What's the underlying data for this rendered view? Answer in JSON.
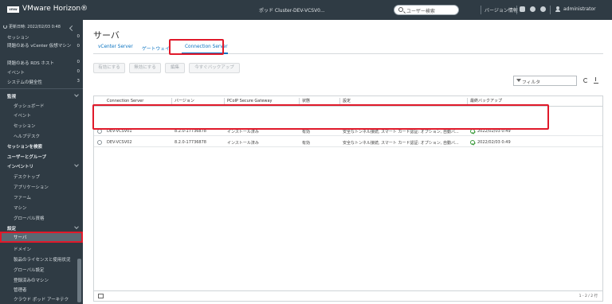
{
  "header": {
    "logo": "vmw",
    "brand": "VMware Horizon®",
    "pod_title": "ポッド Cluster-DEV-VCSV0...",
    "search_placeholder": "ユーザー検索",
    "version_info": "バージョン情報",
    "user": "administrator"
  },
  "sidebar": {
    "updated": "更新日時: 2022/02/03 0:48",
    "counts": [
      {
        "label": "セッション",
        "count": "0"
      },
      {
        "label": "問題のある vCenter 仮想マシン",
        "count": "0"
      },
      {
        "label": "問題のある RDS ホスト",
        "count": "0"
      },
      {
        "label": "イベント",
        "count": "0"
      },
      {
        "label": "システムの健全性",
        "count": "3"
      }
    ],
    "monitor": "監視",
    "monitor_items": [
      "ダッシュボード",
      "イベント",
      "セッション",
      "ヘルプデスク"
    ],
    "session_search": "セッションを検索",
    "users_groups": "ユーザーとグループ",
    "inventory": "インベントリ",
    "inventory_items": [
      "デスクトップ",
      "アプリケーション",
      "ファーム",
      "マシン",
      "グローバル資格"
    ],
    "settings": "設定",
    "settings_items": [
      "サーバ",
      "ドメイン",
      "製品のライセンスと使用状況",
      "グローバル設定",
      "登録済みのマシン",
      "管理者",
      "クラウド ポッド アーキテク"
    ]
  },
  "main": {
    "title": "サーバ",
    "tabs": [
      "vCenter Server",
      "ゲートウェイ",
      "Connection Server"
    ],
    "buttons": [
      "有効にする",
      "無効にする",
      "編集",
      "今すぐバックアップ"
    ],
    "filter_placeholder": "フィルタ",
    "columns": [
      "Connection Server",
      "バージョン",
      "PCoIP Secure Gateway",
      "状態",
      "設定",
      "最終バックアップ"
    ],
    "rows": [
      {
        "server": "DEV-VCSV01",
        "version": "8.2.0-17736878",
        "pcoip": "インストール済み",
        "state": "有効",
        "settings": "安全なトンネル接続, スマート カード認証: オプション, 自動バ...",
        "backup": "2022/02/03 0:49"
      },
      {
        "server": "DEV-VCSV02",
        "version": "8.2.0-17736878",
        "pcoip": "インストール済み",
        "state": "有効",
        "settings": "安全なトンネル接続, スマート カード認証: オプション, 自動バ...",
        "backup": "2022/02/03 0:49"
      }
    ],
    "pagination": "1 - 2 / 2 行"
  },
  "colors": {
    "chrome_bg": "#2f3b44",
    "accent": "#0a73c1",
    "highlight": "#e0192a",
    "ok": "#3c9a3c"
  }
}
